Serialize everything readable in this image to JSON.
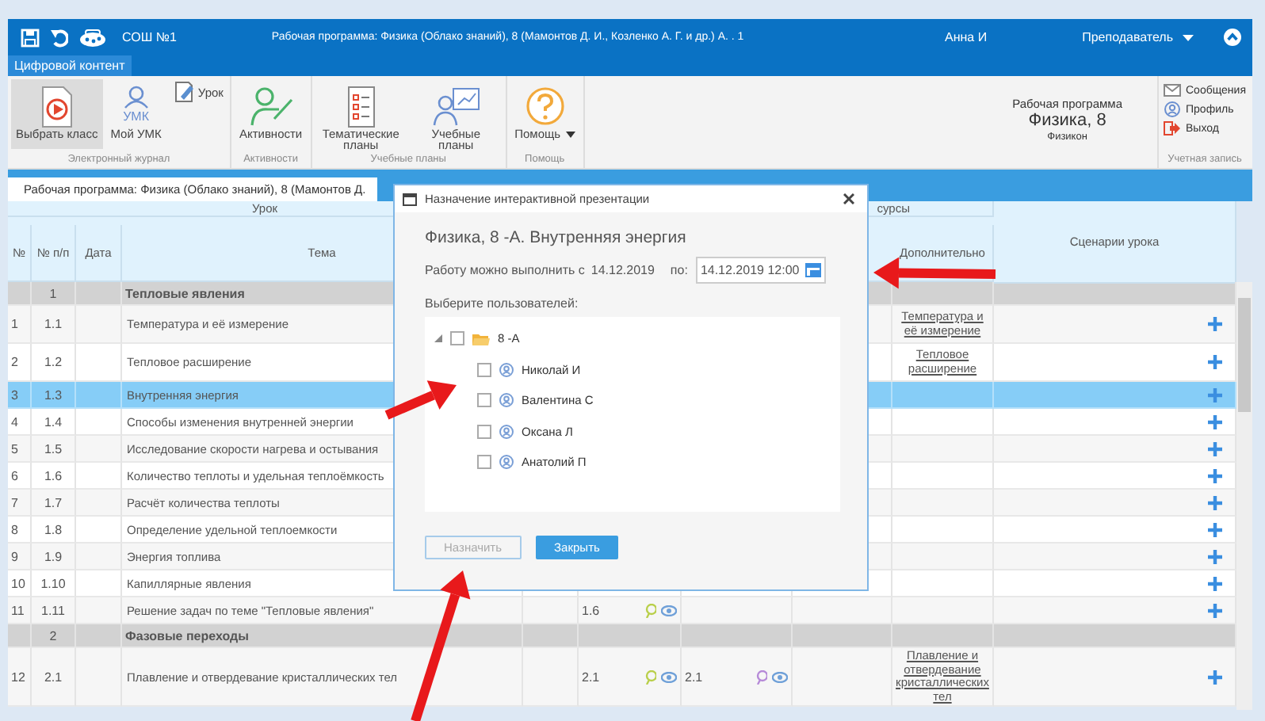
{
  "topbar": {
    "school": "СОШ №1",
    "title": "Рабочая программа: Физика (Облако знаний), 8 (Мамонтов Д. И., Козленко А. Г. и др.) А. . 1",
    "user": "Анна И",
    "role": "Преподаватель"
  },
  "tabs": [
    {
      "label": "Цифровой контент",
      "selected": true
    }
  ],
  "ribbon": {
    "groups": [
      {
        "label": "Электронный журнал",
        "buttons": [
          {
            "kind": "large",
            "label": "Выбрать класс",
            "selected": true
          },
          {
            "kind": "large",
            "badge": "УМК",
            "label": "Мой УМК",
            "selected": false
          },
          {
            "kind": "small",
            "label": "Урок",
            "selected": false
          }
        ]
      },
      {
        "label": "Активности",
        "buttons": [
          {
            "kind": "large",
            "label": "Активности",
            "selected": false
          }
        ]
      },
      {
        "label": "Учебные планы",
        "buttons": [
          {
            "kind": "large",
            "label": "Тематические планы",
            "selected": false
          },
          {
            "kind": "large",
            "label": "Учебные планы",
            "selected": false
          }
        ]
      },
      {
        "label": "Помощь",
        "buttons": [
          {
            "kind": "menu",
            "label": "Помощь",
            "selected": false
          }
        ]
      }
    ],
    "program": {
      "caption": "Рабочая программа",
      "title": "Физика, 8",
      "publisher": "Физикон"
    },
    "account": {
      "label": "Учетная запись",
      "items": [
        "Сообщения",
        "Профиль",
        "Выход"
      ]
    }
  },
  "document_tab": {
    "label": "Рабочая программа: Физика (Облако знаний), 8 (Мамонтов Д."
  },
  "table": {
    "group_headers": [
      "Урок",
      "сурсы"
    ],
    "columns": [
      "№",
      "№ п/п",
      "Дата",
      "Тема",
      "Дополнительно",
      "Сценарии урока"
    ],
    "rows": [
      {
        "kind": "section",
        "pp": "1",
        "topic": "Тепловые явления",
        "selected": false
      },
      {
        "kind": "lesson",
        "num": "1",
        "pp": "1.1",
        "topic": "Температура и её измерение",
        "extra": "Температура и её измерение",
        "selected": false
      },
      {
        "kind": "lesson",
        "num": "2",
        "pp": "1.2",
        "topic": "Тепловое расширение",
        "extra": "Тепловое расширение",
        "selected": false
      },
      {
        "kind": "lesson",
        "num": "3",
        "pp": "1.3",
        "topic": "Внутренняя энергия",
        "selected": true
      },
      {
        "kind": "lesson",
        "num": "4",
        "pp": "1.4",
        "topic": "Способы изменения внутренней энергии",
        "selected": false
      },
      {
        "kind": "lesson",
        "num": "5",
        "pp": "1.5",
        "topic": "Исследование скорости нагрева и остывания",
        "selected": false
      },
      {
        "kind": "lesson",
        "num": "6",
        "pp": "1.6",
        "topic": "Количество теплоты и удельная теплоёмкость",
        "selected": false
      },
      {
        "kind": "lesson",
        "num": "7",
        "pp": "1.7",
        "topic": "Расчёт количества теплоты",
        "selected": false
      },
      {
        "kind": "lesson",
        "num": "8",
        "pp": "1.8",
        "topic": "Определение удельной теплоемкости",
        "selected": false
      },
      {
        "kind": "lesson",
        "num": "9",
        "pp": "1.9",
        "topic": "Энергия топлива",
        "selected": false
      },
      {
        "kind": "lesson",
        "num": "10",
        "pp": "1.10",
        "topic": "Капиллярные явления",
        "selected": false
      },
      {
        "kind": "lesson",
        "num": "11",
        "pp": "1.11",
        "topic": "Решение задач по теме \"Тепловые явления\"",
        "resource_1": "1.6",
        "selected": false
      },
      {
        "kind": "section",
        "pp": "2",
        "topic": "Фазовые переходы",
        "selected": false
      },
      {
        "kind": "lesson",
        "num": "12",
        "pp": "2.1",
        "topic": "Плавление и отвердевание кристаллических тел",
        "resource_1": "2.1",
        "resource_2": "2.1",
        "extra": "Плавление и отвердевание кристаллических тел",
        "selected": false
      }
    ]
  },
  "dialog": {
    "title": "Назначение интерактивной презентации",
    "heading": "Физика, 8 -А. Внутренняя энергия",
    "date_label": "Работу можно выполнить с",
    "date_from": "14.12.2019",
    "to_label": "по:",
    "date_to": "14.12.2019 12:00",
    "users_label": "Выберите пользователей:",
    "tree": [
      {
        "label": "8 -А",
        "expanded": true,
        "checked": false,
        "children": [
          {
            "label": "Николай И",
            "checked": false
          },
          {
            "label": "Валентина С",
            "checked": false
          },
          {
            "label": "Оксана Л",
            "checked": false
          },
          {
            "label": "Анатолий П",
            "checked": false
          }
        ]
      }
    ],
    "buttons": [
      {
        "label": "Назначить",
        "kind": "secondary",
        "disabled": true
      },
      {
        "label": "Закрыть",
        "kind": "primary",
        "disabled": false
      }
    ]
  }
}
